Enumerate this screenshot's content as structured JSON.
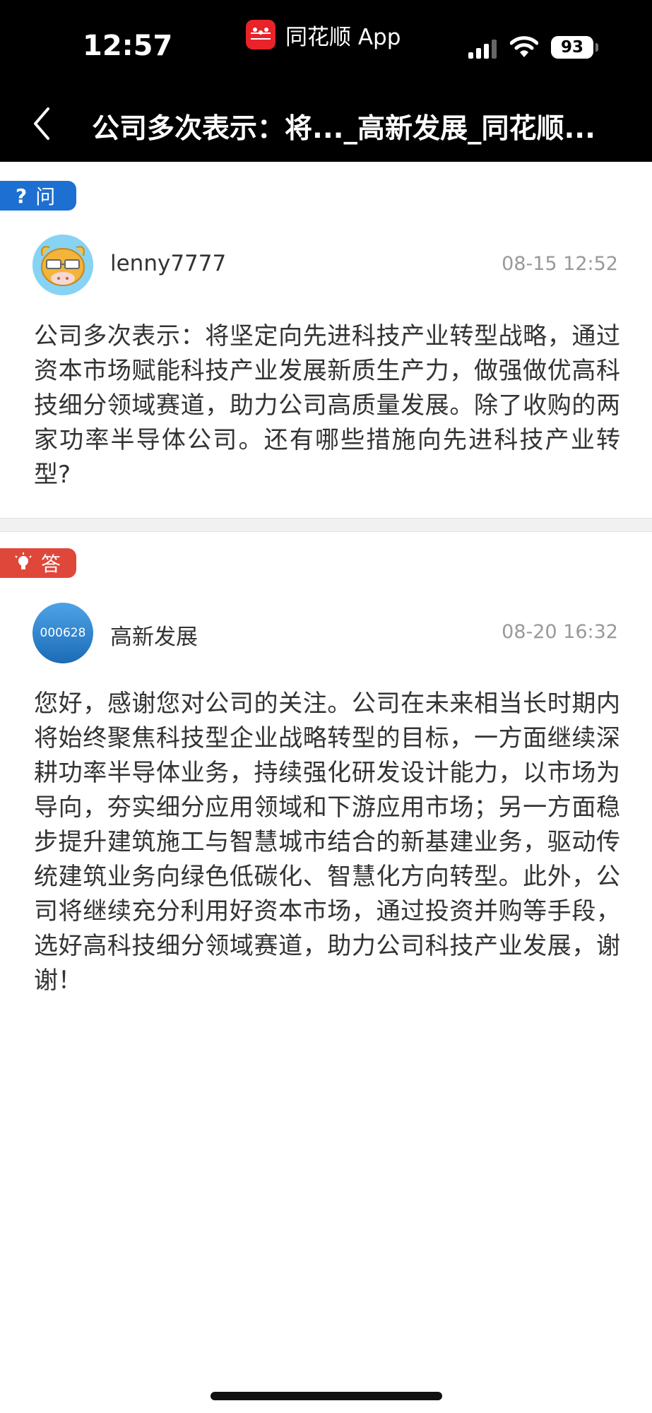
{
  "status_bar": {
    "time": "12:57",
    "app_name": "同花顺 App",
    "battery": "93"
  },
  "nav": {
    "title": "公司多次表示：将..._高新发展_同花顺..."
  },
  "question": {
    "tag_label": "问",
    "username": "lenny7777",
    "date": "08-15 12:52",
    "content": "公司多次表示：将坚定向先进科技产业转型战略，通过资本市场赋能科技产业发展新质生产力，做强做优高科技细分领域赛道，助力公司高质量发展。除了收购的两家功率半导体公司。还有哪些措施向先进科技产业转型?"
  },
  "answer": {
    "tag_label": "答",
    "avatar_code": "000628",
    "username": "高新发展",
    "date": "08-20 16:32",
    "content": "您好，感谢您对公司的关注。公司在未来相当长时期内将始终聚焦科技型企业战略转型的目标，一方面继续深耕功率半导体业务，持续强化研发设计能力，以市场为导向，夯实细分应用领域和下游应用市场；另一方面稳步提升建筑施工与智慧城市结合的新基建业务，驱动传统建筑业务向绿色低碳化、智慧化方向转型。此外，公司将继续充分利用好资本市场，通过投资并购等手段，选好高科技细分领域赛道，助力公司科技产业发展，谢谢！"
  }
}
